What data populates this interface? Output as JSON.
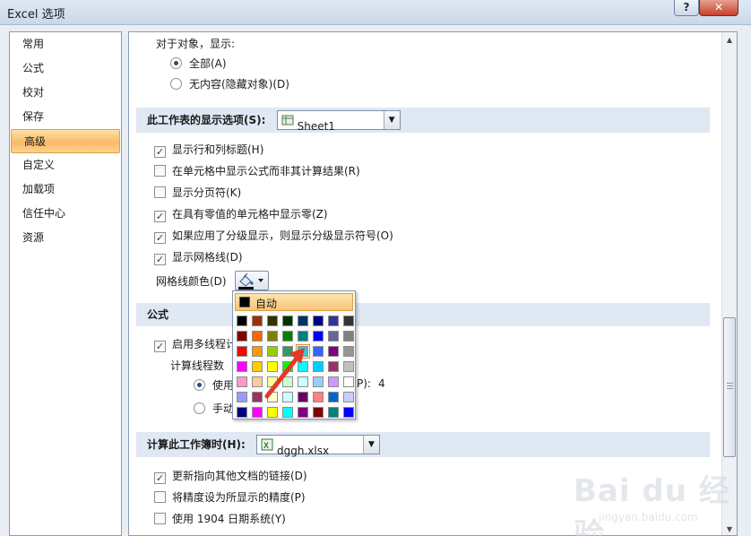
{
  "window": {
    "title": "Excel 选项",
    "help_label": "?",
    "close_label": "✕"
  },
  "nav": {
    "items": [
      {
        "label": "常用"
      },
      {
        "label": "公式"
      },
      {
        "label": "校对"
      },
      {
        "label": "保存"
      },
      {
        "label": "高级",
        "active": true
      },
      {
        "label": "自定义"
      },
      {
        "label": "加载项"
      },
      {
        "label": "信任中心"
      },
      {
        "label": "资源"
      }
    ]
  },
  "objects": {
    "heading": "对于对象，显示:",
    "opt_all": "全部(A)",
    "opt_none": "无内容(隐藏对象)(D)"
  },
  "sheet_section": {
    "title": "此工作表的显示选项(S):",
    "sheet_value": "Sheet1",
    "options": [
      {
        "label": "显示行和列标题(H)",
        "checked": true
      },
      {
        "label": "在单元格中显示公式而非其计算结果(R)",
        "checked": false
      },
      {
        "label": "显示分页符(K)",
        "checked": false
      },
      {
        "label": "在具有零值的单元格中显示零(Z)",
        "checked": true
      },
      {
        "label": "如果应用了分级显示，则显示分级显示符号(O)",
        "checked": true
      },
      {
        "label": "显示网格线(D)",
        "checked": true
      }
    ],
    "gridline_color_label": "网格线颜色(D)"
  },
  "palette": {
    "auto_label": "自动",
    "colors": [
      [
        "#000000",
        "#993300",
        "#333300",
        "#003300",
        "#003366",
        "#000080",
        "#333399",
        "#333333"
      ],
      [
        "#800000",
        "#FF6600",
        "#808000",
        "#008000",
        "#008080",
        "#0000FF",
        "#666699",
        "#808080"
      ],
      [
        "#FF0000",
        "#FF9900",
        "#99CC00",
        "#339966",
        "#33CCCC",
        "#3366FF",
        "#800080",
        "#969696"
      ],
      [
        "#FF00FF",
        "#FFCC00",
        "#FFFF00",
        "#00FF00",
        "#00FFFF",
        "#00CCFF",
        "#993366",
        "#C0C0C0"
      ],
      [
        "#FF99CC",
        "#FFCC99",
        "#FFFF99",
        "#CCFFCC",
        "#CCFFFF",
        "#99CCFF",
        "#CC99FF",
        "#FFFFFF"
      ],
      [
        "#9999FF",
        "#993366",
        "#FFFFCC",
        "#CCFFFF",
        "#660066",
        "#FF8080",
        "#0066CC",
        "#CCCCFF"
      ],
      [
        "#000080",
        "#FF00FF",
        "#FFFF00",
        "#00FFFF",
        "#800080",
        "#800000",
        "#008080",
        "#0000FF"
      ]
    ]
  },
  "formula_section": {
    "title": "公式",
    "multithread_label": "启用多线程计",
    "threads_label": "计算线程数",
    "use_label": "使用",
    "use_suffix": "P):",
    "thread_count": "4",
    "manual_label": "手动"
  },
  "workbook_section": {
    "title": "计算此工作簿时(H):",
    "workbook_value": "dggh.xlsx",
    "options": [
      {
        "label": "更新指向其他文档的链接(D)",
        "checked": true
      },
      {
        "label": "将精度设为所显示的精度(P)",
        "checked": false
      },
      {
        "label": "使用 1904 日期系统(Y)",
        "checked": false
      }
    ]
  },
  "watermark": {
    "brand": "Bai du 经验",
    "url": "jingyan.baidu.com"
  },
  "colors": {
    "section_header_bg": "#dfe8f3",
    "nav_active": "#f9b96a",
    "annotation_arrow": "#e03a2a"
  }
}
